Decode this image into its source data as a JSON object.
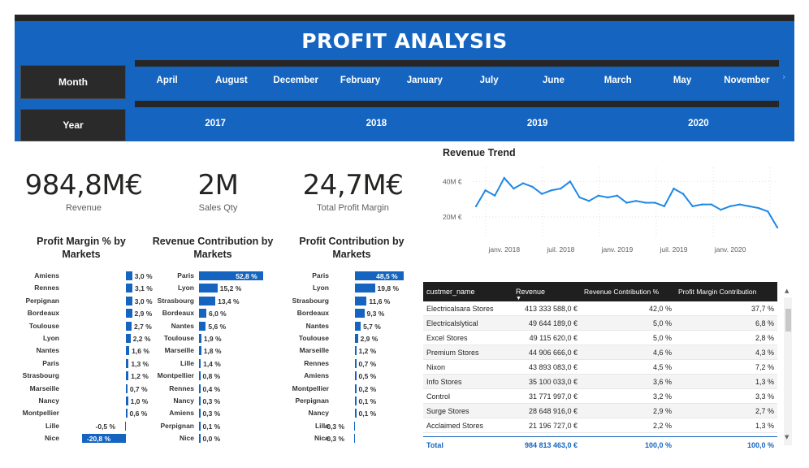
{
  "header": {
    "title": "PROFIT ANALYSIS",
    "month_label": "Month",
    "year_label": "Year",
    "months": [
      "April",
      "August",
      "December",
      "February",
      "January",
      "July",
      "June",
      "March",
      "May",
      "November"
    ],
    "years": [
      "2017",
      "2018",
      "2019",
      "2020"
    ],
    "scroll_arrow": "›"
  },
  "kpis": [
    {
      "value": "984,8M€",
      "label": "Revenue"
    },
    {
      "value": "2M",
      "label": "Sales Qty"
    },
    {
      "value": "24,7M€",
      "label": "Total Profit Margin"
    }
  ],
  "profit_margin": {
    "title": "Profit Margin % by Markets",
    "rows": [
      {
        "label": "Amiens",
        "value": 3.0,
        "text": "3,0 %"
      },
      {
        "label": "Rennes",
        "value": 3.1,
        "text": "3,1 %"
      },
      {
        "label": "Perpignan",
        "value": 3.0,
        "text": "3,0 %"
      },
      {
        "label": "Bordeaux",
        "value": 2.9,
        "text": "2,9 %"
      },
      {
        "label": "Toulouse",
        "value": 2.7,
        "text": "2,7 %"
      },
      {
        "label": "Lyon",
        "value": 2.2,
        "text": "2,2 %"
      },
      {
        "label": "Nantes",
        "value": 1.6,
        "text": "1,6 %"
      },
      {
        "label": "Paris",
        "value": 1.3,
        "text": "1,3 %"
      },
      {
        "label": "Strasbourg",
        "value": 1.2,
        "text": "1,2 %"
      },
      {
        "label": "Marseille",
        "value": 0.7,
        "text": "0,7 %"
      },
      {
        "label": "Nancy",
        "value": 1.0,
        "text": "1,0 %"
      },
      {
        "label": "Montpellier",
        "value": 0.6,
        "text": "0,6 %"
      },
      {
        "label": "Lille",
        "value": -0.5,
        "text": "-0,5 %"
      },
      {
        "label": "Nice",
        "value": -20.8,
        "text": "-20,8 %"
      }
    ]
  },
  "revenue_contribution": {
    "title": "Revenue Contribution by Markets",
    "rows": [
      {
        "label": "Paris",
        "value": 52.8,
        "text": "52,8 %"
      },
      {
        "label": "Lyon",
        "value": 15.2,
        "text": "15,2 %"
      },
      {
        "label": "Strasbourg",
        "value": 13.4,
        "text": "13,4 %"
      },
      {
        "label": "Bordeaux",
        "value": 6.0,
        "text": "6,0 %"
      },
      {
        "label": "Nantes",
        "value": 5.6,
        "text": "5,6 %"
      },
      {
        "label": "Toulouse",
        "value": 1.9,
        "text": "1,9 %"
      },
      {
        "label": "Marseille",
        "value": 1.8,
        "text": "1,8 %"
      },
      {
        "label": "Lille",
        "value": 1.4,
        "text": "1,4 %"
      },
      {
        "label": "Montpellier",
        "value": 0.8,
        "text": "0,8 %"
      },
      {
        "label": "Rennes",
        "value": 0.4,
        "text": "0,4 %"
      },
      {
        "label": "Nancy",
        "value": 0.3,
        "text": "0,3 %"
      },
      {
        "label": "Amiens",
        "value": 0.3,
        "text": "0,3 %"
      },
      {
        "label": "Perpignan",
        "value": 0.1,
        "text": "0,1 %"
      },
      {
        "label": "Nice",
        "value": 0.0,
        "text": "0,0 %"
      }
    ]
  },
  "profit_contribution": {
    "title": "Profit Contribution by Markets",
    "rows": [
      {
        "label": "Paris",
        "value": 48.5,
        "text": "48,5 %"
      },
      {
        "label": "Lyon",
        "value": 19.8,
        "text": "19,8 %"
      },
      {
        "label": "Strasbourg",
        "value": 11.6,
        "text": "11,6 %"
      },
      {
        "label": "Bordeaux",
        "value": 9.3,
        "text": "9,3 %"
      },
      {
        "label": "Nantes",
        "value": 5.7,
        "text": "5,7 %"
      },
      {
        "label": "Toulouse",
        "value": 2.9,
        "text": "2,9 %"
      },
      {
        "label": "Marseille",
        "value": 1.2,
        "text": "1,2 %"
      },
      {
        "label": "Rennes",
        "value": 0.7,
        "text": "0,7 %"
      },
      {
        "label": "Amiens",
        "value": 0.5,
        "text": "0,5 %"
      },
      {
        "label": "Montpellier",
        "value": 0.2,
        "text": "0,2 %"
      },
      {
        "label": "Perpignan",
        "value": 0.1,
        "text": "0,1 %"
      },
      {
        "label": "Nancy",
        "value": 0.1,
        "text": "0,1 %"
      },
      {
        "label": "Lille",
        "value": -0.3,
        "text": "-0,3 %"
      },
      {
        "label": "Nice",
        "value": -0.3,
        "text": "-0,3 %"
      }
    ]
  },
  "chart_data": {
    "type": "line",
    "title": "Revenue Trend",
    "xlabel": "",
    "ylabel": "",
    "x_ticks": [
      "janv. 2018",
      "juil. 2018",
      "janv. 2019",
      "juil. 2019",
      "janv. 2020"
    ],
    "y_ticks": [
      "40M €",
      "20M €"
    ],
    "y_tick_values": [
      40,
      20
    ],
    "ylim": [
      8,
      48
    ],
    "series": [
      {
        "name": "",
        "color": "#1e88e5",
        "x": [
          "2017-10",
          "2017-11",
          "2017-12",
          "2018-01",
          "2018-02",
          "2018-03",
          "2018-04",
          "2018-05",
          "2018-06",
          "2018-07",
          "2018-08",
          "2018-09",
          "2018-10",
          "2018-11",
          "2018-12",
          "2019-01",
          "2019-02",
          "2019-03",
          "2019-04",
          "2019-05",
          "2019-06",
          "2019-07",
          "2019-08",
          "2019-09",
          "2019-10",
          "2019-11",
          "2019-12",
          "2020-01",
          "2020-02",
          "2020-03",
          "2020-04",
          "2020-05",
          "2020-06"
        ],
        "values": [
          26,
          35,
          32,
          42,
          36,
          39,
          37,
          33,
          35,
          36,
          40,
          31,
          29,
          32,
          31,
          32,
          28,
          29,
          28,
          28,
          26,
          36,
          33,
          26,
          27,
          27,
          24,
          26,
          27,
          26,
          25,
          23,
          14
        ]
      }
    ]
  },
  "table": {
    "headers": [
      "custmer_name",
      "Revenue",
      "Revenue Contribution %",
      "Profit Margin Contribution"
    ],
    "sort_indicator": "▼",
    "rows": [
      [
        "Electricalsara Stores",
        "413 333 588,0 €",
        "42,0 %",
        "37,7 %"
      ],
      [
        "Electricalslytical",
        "49 644 189,0 €",
        "5,0 %",
        "6,8 %"
      ],
      [
        "Excel Stores",
        "49 115 620,0 €",
        "5,0 %",
        "2,8 %"
      ],
      [
        "Premium Stores",
        "44 906 666,0 €",
        "4,6 %",
        "4,3 %"
      ],
      [
        "Nixon",
        "43 893 083,0 €",
        "4,5 %",
        "7,2 %"
      ],
      [
        "Info Stores",
        "35 100 033,0 €",
        "3,6 %",
        "1,3 %"
      ],
      [
        "Control",
        "31 771 997,0 €",
        "3,2 %",
        "3,3 %"
      ],
      [
        "Surge Stores",
        "28 648 916,0 €",
        "2,9 %",
        "2,7 %"
      ],
      [
        "Acclaimed Stores",
        "21 196 727,0 €",
        "2,2 %",
        "1,3 %"
      ]
    ],
    "total": [
      "Total",
      "984 813 463,0 €",
      "100,0 %",
      "100,0 %"
    ],
    "scroll_up": "▲",
    "scroll_down": "▼"
  },
  "colors": {
    "accent": "#1565c0",
    "header_dark": "#252525",
    "line": "#1e88e5"
  }
}
